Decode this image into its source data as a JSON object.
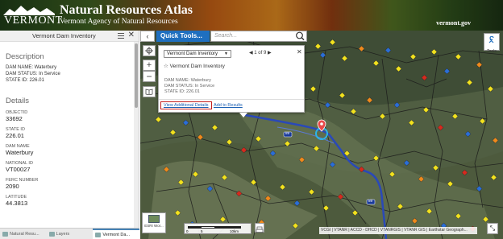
{
  "header": {
    "logo_text": "VERMONT",
    "title": "Natural Resources Atlas",
    "subtitle": "Vermont Agency of Natural Resources",
    "site": "vermont.gov"
  },
  "panel": {
    "title": "Vermont Dam Inventory",
    "description_heading": "Description",
    "description_lines": [
      "DAM NAME: Waterbury",
      "DAM STATUS: In Service",
      "STATE ID: 226.01"
    ],
    "details_heading": "Details",
    "fields": [
      {
        "label": "OBJECTID",
        "value": "33692"
      },
      {
        "label": "STATE ID",
        "value": "226.01"
      },
      {
        "label": "DAM NAME",
        "value": "Waterbury"
      },
      {
        "label": "NATIONAL ID",
        "value": "VT00027"
      },
      {
        "label": "FERC NUMBER",
        "value": "2090"
      },
      {
        "label": "LATITUDE",
        "value": "44.3813"
      }
    ]
  },
  "tabs": [
    {
      "label": "Natural Resu..."
    },
    {
      "label": "Layers"
    },
    {
      "label": "Vermont Da..."
    }
  ],
  "toolbar": {
    "quick_tools": "Quick Tools...",
    "search_placeholder": "Search...",
    "tools_label": "Tools"
  },
  "popup": {
    "layer_select": "Vermont Dam Inventory",
    "pager": "1 of 9",
    "title": "Vermont Dam Inventory",
    "lines": [
      "DAM NAME: Waterbury",
      "DAM STATUS: In Service",
      "STATE ID: 226.01"
    ],
    "view_details": "View Additional Details",
    "add_results": "Add to Results"
  },
  "map": {
    "road_labels": [
      "89",
      "89"
    ],
    "basemap_label": "ESRI Wor...",
    "scale": {
      "l0": "0",
      "l1": "5",
      "l2": "10km"
    },
    "attribution": "VCGI | VTANR | ACCD - DHCD | VTANRGIS | VTANR GIS | Earthstar Geograph..."
  },
  "colors": {
    "accent": "#1f6fbf",
    "dam_yellow": "#f2e21e",
    "dam_orange": "#f08a1c",
    "dam_red": "#d62a1e",
    "dam_blue": "#2b6ed6",
    "highlight_box": "#c41e1e"
  }
}
